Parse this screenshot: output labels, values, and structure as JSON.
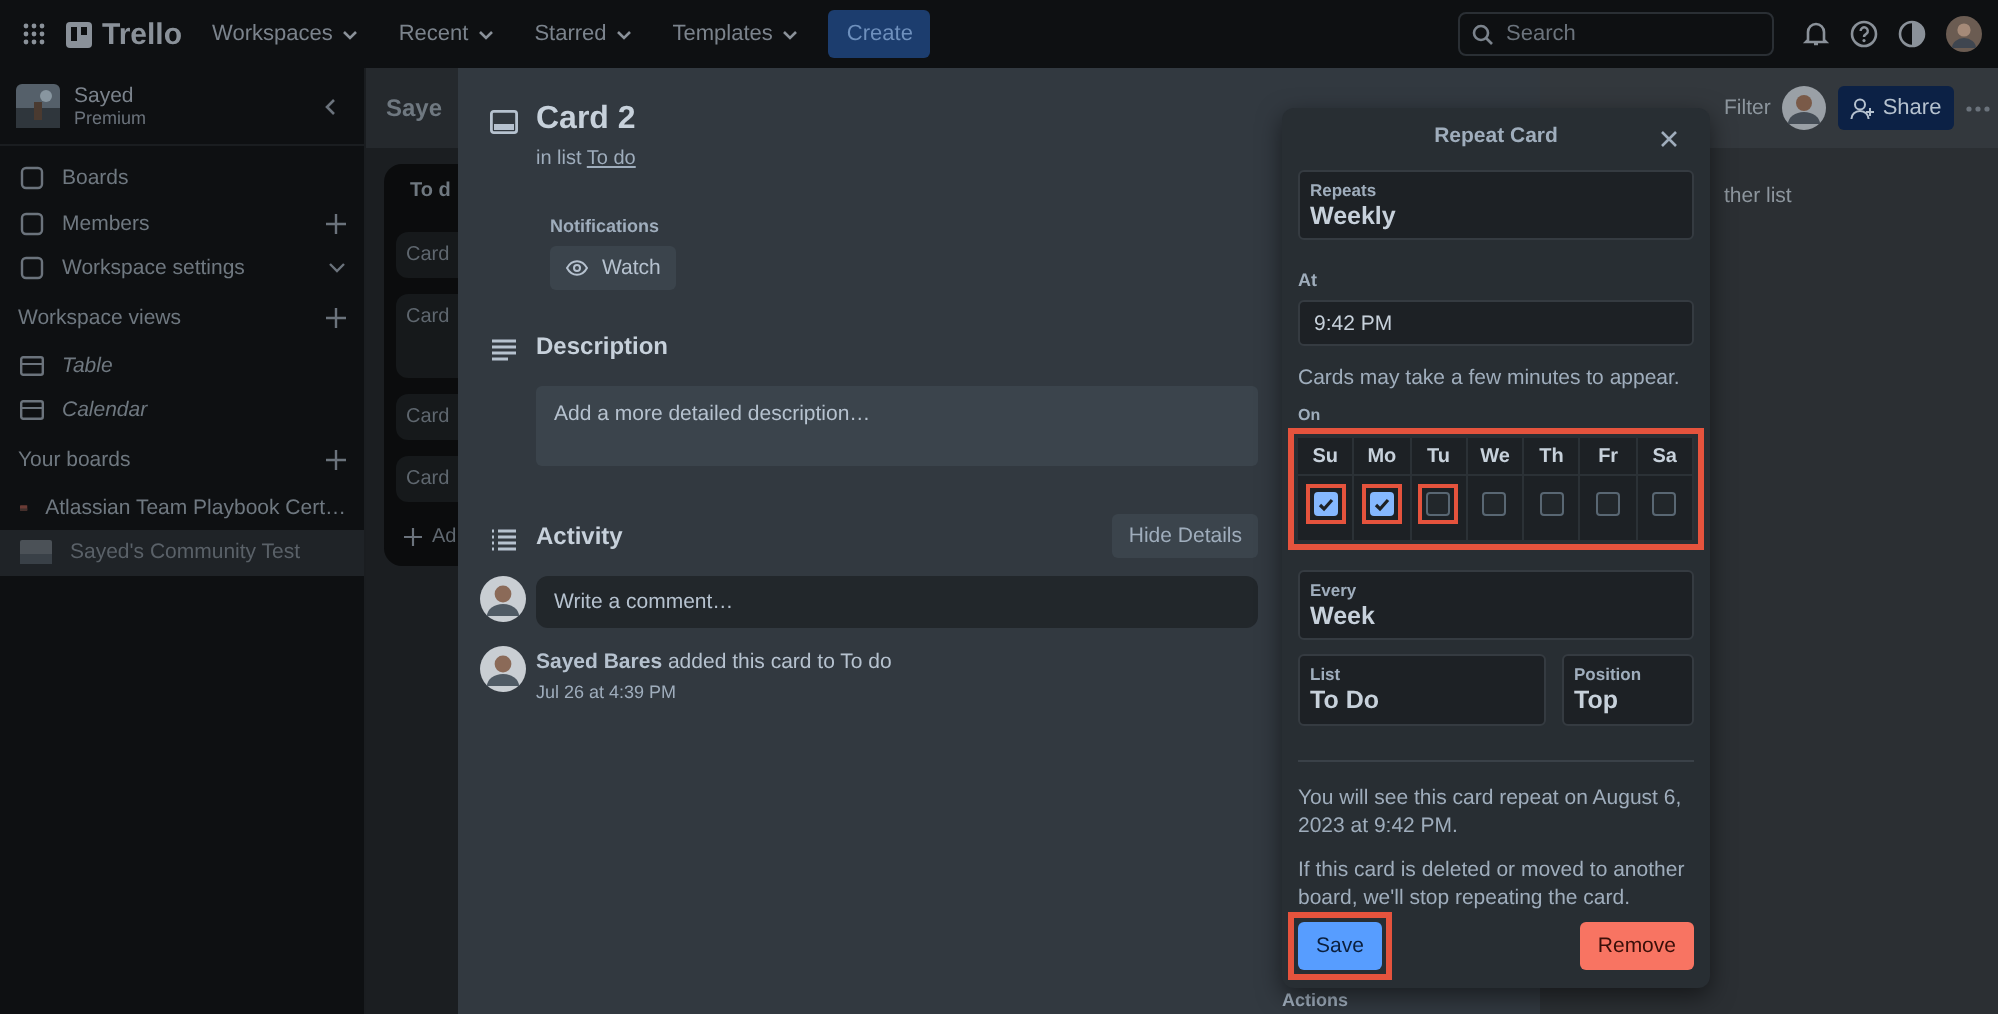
{
  "topbar": {
    "logo": "Trello",
    "menus": [
      "Workspaces",
      "Recent",
      "Starred",
      "Templates"
    ],
    "create": "Create",
    "search": {
      "placeholder": "Search"
    }
  },
  "sidebar": {
    "workspace": {
      "name": "Sayed",
      "plan": "Premium"
    },
    "items": [
      {
        "label": "Boards",
        "kind": "plain"
      },
      {
        "label": "Members",
        "kind": "add"
      },
      {
        "label": "Workspace settings",
        "kind": "expand"
      }
    ],
    "views_heading": "Workspace views",
    "views": [
      "Table",
      "Calendar"
    ],
    "boards_heading": "Your boards",
    "boards": [
      {
        "label": "Atlassian Team Playbook Cert…",
        "selected": false
      },
      {
        "label": "Sayed's Community Test",
        "selected": true
      }
    ]
  },
  "board": {
    "title": "Saye",
    "list_title": "To d",
    "cards": [
      "Card",
      "Card",
      "Card",
      "Card"
    ],
    "add_card": "Ad",
    "filter": "Filter",
    "share": "Share",
    "add_list": "ther list"
  },
  "card": {
    "title": "Card 2",
    "in_list": "in list",
    "list_link": "To do",
    "notifications_label": "Notifications",
    "watch": "Watch",
    "description_heading": "Description",
    "description_placeholder": "Add a more detailed description…",
    "activity_heading": "Activity",
    "hide_details": "Hide Details",
    "comment_placeholder": "Write a comment…",
    "activity": [
      {
        "text": "**Sayed Bares** added this card to To do",
        "time": "Jul 26 at 4:39 PM"
      }
    ],
    "actions_label": "Actions"
  },
  "repeat": {
    "title": "Repeat Card",
    "repeats": {
      "label": "Repeats",
      "value": "Weekly"
    },
    "at": {
      "label": "At",
      "value": "9:42 PM"
    },
    "note": "Cards may take a few minutes to appear.",
    "on_label": "On",
    "days_highlighted": true,
    "days": [
      {
        "label": "Su",
        "checked": true,
        "highlighted": true
      },
      {
        "label": "Mo",
        "checked": true,
        "highlighted": true
      },
      {
        "label": "Tu",
        "checked": false,
        "highlighted": true
      },
      {
        "label": "We",
        "checked": false,
        "highlighted": false
      },
      {
        "label": "Th",
        "checked": false,
        "highlighted": false
      },
      {
        "label": "Fr",
        "checked": false,
        "highlighted": false
      },
      {
        "label": "Sa",
        "checked": false,
        "highlighted": false
      }
    ],
    "every": {
      "label": "Every",
      "value": "Week"
    },
    "list": {
      "label": "List",
      "value": "To Do"
    },
    "position": {
      "label": "Position",
      "value": "Top"
    },
    "summary": "You will see this card repeat on August 6, 2023 at 9:42 PM.",
    "warning": "If this card is deleted or moved to another board, we'll stop repeating the card.",
    "save": {
      "label": "Save",
      "highlighted": true
    },
    "remove": "Remove"
  }
}
